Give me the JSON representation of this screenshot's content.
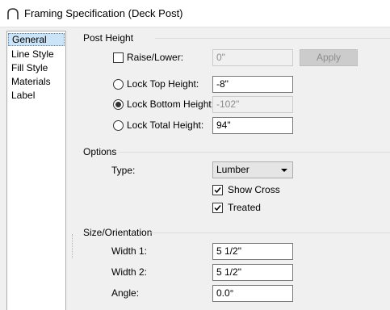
{
  "window": {
    "title": "Framing Specification (Deck Post)"
  },
  "sidebar": {
    "items": [
      {
        "label": "General",
        "selected": true
      },
      {
        "label": "Line Style",
        "selected": false
      },
      {
        "label": "Fill Style",
        "selected": false
      },
      {
        "label": "Materials",
        "selected": false
      },
      {
        "label": "Label",
        "selected": false
      }
    ]
  },
  "post_height": {
    "group_label": "Post Height",
    "raise_lower": {
      "label": "Raise/Lower:",
      "value": "0\"",
      "checked": false
    },
    "apply_label": "Apply",
    "lock_top": {
      "label": "Lock Top Height:",
      "value": "-8\"",
      "selected": false
    },
    "lock_bottom": {
      "label": "Lock Bottom Height:",
      "value": "-102\"",
      "selected": true
    },
    "lock_total": {
      "label": "Lock Total Height:",
      "value": "94\"",
      "selected": false
    }
  },
  "options": {
    "group_label": "Options",
    "type_label": "Type:",
    "type_value": "Lumber",
    "show_cross": {
      "label": "Show Cross",
      "checked": true
    },
    "treated": {
      "label": "Treated",
      "checked": true
    }
  },
  "size_orientation": {
    "group_label": "Size/Orientation",
    "width1": {
      "label": "Width 1:",
      "value": "5 1/2\""
    },
    "width2": {
      "label": "Width 2:",
      "value": "5 1/2\""
    },
    "angle": {
      "label": "Angle:",
      "value": "0.0°"
    }
  }
}
